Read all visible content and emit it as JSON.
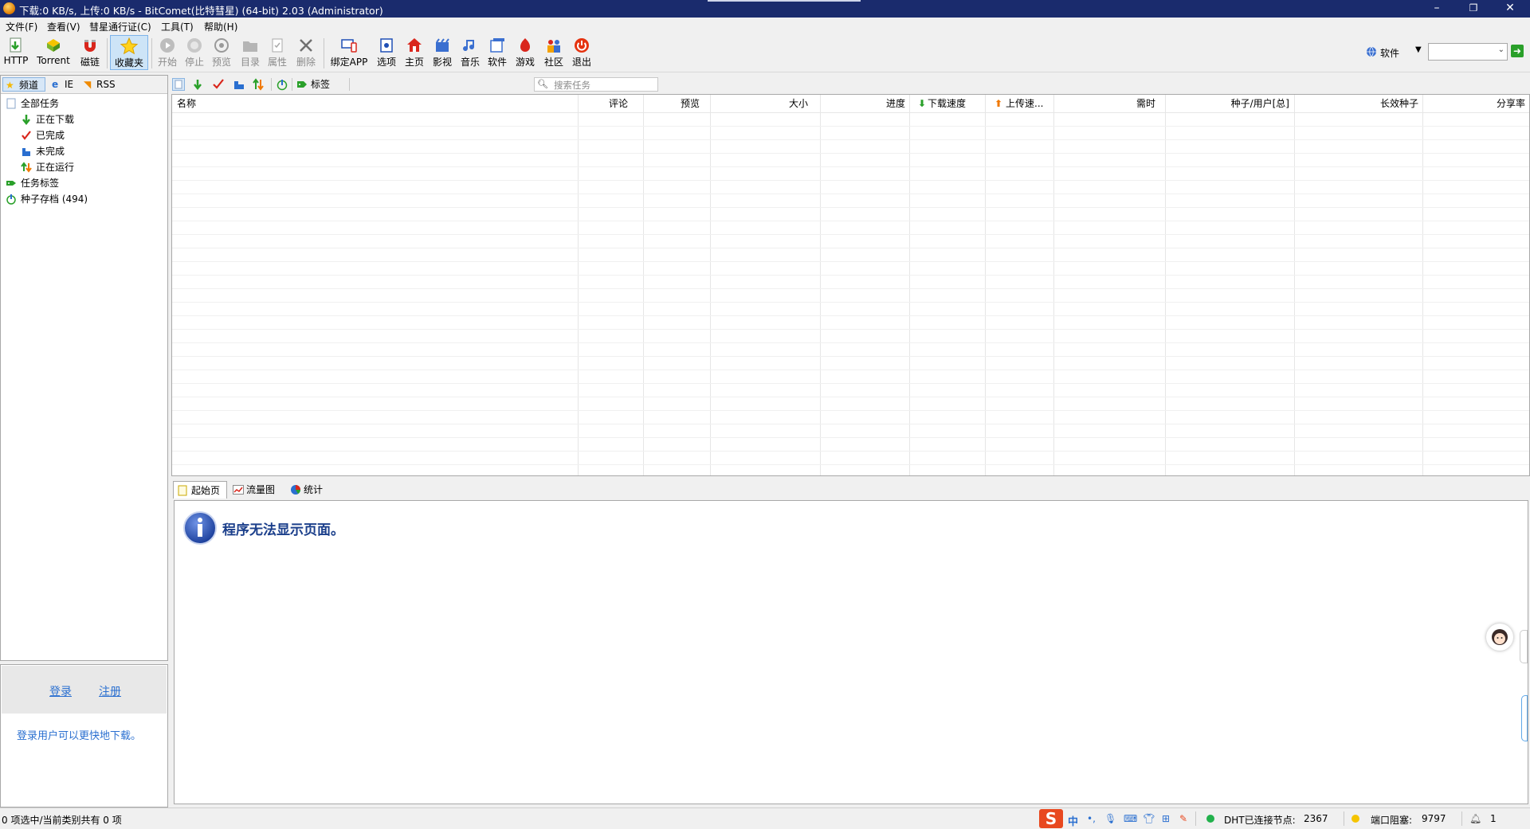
{
  "window": {
    "title": "下载:0 KB/s, 上传:0 KB/s - BitComet(比特彗星) (64-bit) 2.03 (Administrator)",
    "minimize": "–",
    "restore": "❐",
    "close": "✕"
  },
  "menu": [
    "文件(F)",
    "查看(V)",
    "彗星通行证(C)",
    "工具(T)",
    "帮助(H)"
  ],
  "toolbar": {
    "http": "HTTP",
    "torrent": "Torrent",
    "magnet": "磁链",
    "favorites": "收藏夹",
    "start": "开始",
    "stop": "停止",
    "preview": "预览",
    "directory": "目录",
    "properties": "属性",
    "delete": "删除",
    "bind_app": "绑定APP",
    "options": "选项",
    "home": "主页",
    "video": "影视",
    "music": "音乐",
    "software": "软件",
    "games": "游戏",
    "community": "社区",
    "exit": "退出",
    "search_category": "软件",
    "search_value": ""
  },
  "left_tabs": [
    "频道",
    "IE",
    "RSS"
  ],
  "tree": {
    "all_tasks": "全部任务",
    "downloading": "正在下载",
    "completed": "已完成",
    "incomplete": "未完成",
    "running": "正在运行",
    "task_tags": "任务标签",
    "torrent_archive": "种子存档 (494)"
  },
  "list_toolbar": {
    "tags": "标签",
    "search_placeholder": "搜索任务"
  },
  "columns": [
    "名称",
    "评论",
    "预览",
    "大小",
    "进度",
    "下载速度",
    "上传速...",
    "需时",
    "种子/用户[总]",
    "长效种子",
    "分享率"
  ],
  "bottom_tabs": [
    "起始页",
    "流量图",
    "统计"
  ],
  "page_message": "程序无法显示页面。",
  "login": {
    "login": "登录",
    "register": "注册",
    "hint": "登录用户可以更快地下载。"
  },
  "status": {
    "selection": "0 项选中/当前类别共有 0 项",
    "ime": "中",
    "dht_label": "DHT已连接节点:",
    "dht_value": "2367",
    "port_label": "端口阻塞:",
    "port_value": "9797",
    "notify_count": "1"
  },
  "colors": {
    "title_bar": "#1a2b6d",
    "accent_blue": "#2a6fd0",
    "dht_green": "#22b14c",
    "port_yellow": "#f5c400"
  }
}
